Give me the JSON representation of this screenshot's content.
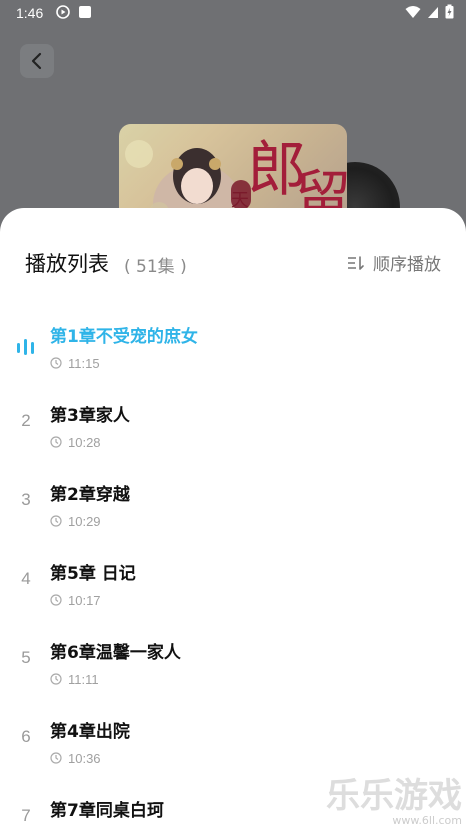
{
  "status_bar": {
    "time": "1:46",
    "icons": [
      "media-icon",
      "card-icon",
      "wifi-icon",
      "signal-icon",
      "battery-icon"
    ]
  },
  "player": {
    "back_icon": "back-arrow-icon",
    "cover_text": "天 郎 留"
  },
  "playlist": {
    "title": "播放列表",
    "count": "( 51集 )",
    "order_label": "顺序播放",
    "order_icon": "sort-order-icon",
    "active_color": "#2fb4e8",
    "episodes": [
      {
        "index": "",
        "title": "第1章不受宠的庶女",
        "duration": "11:15",
        "active": true
      },
      {
        "index": "2",
        "title": "第3章家人",
        "duration": "10:28",
        "active": false
      },
      {
        "index": "3",
        "title": "第2章穿越",
        "duration": "10:29",
        "active": false
      },
      {
        "index": "4",
        "title": "第5章 日记",
        "duration": "10:17",
        "active": false
      },
      {
        "index": "5",
        "title": "第6章温馨一家人",
        "duration": "11:11",
        "active": false
      },
      {
        "index": "6",
        "title": "第4章出院",
        "duration": "10:36",
        "active": false
      },
      {
        "index": "7",
        "title": "第7章同桌白珂",
        "duration": "",
        "active": false
      }
    ]
  },
  "watermark": {
    "text": "乐乐游戏",
    "url": "www.6ll.com"
  }
}
